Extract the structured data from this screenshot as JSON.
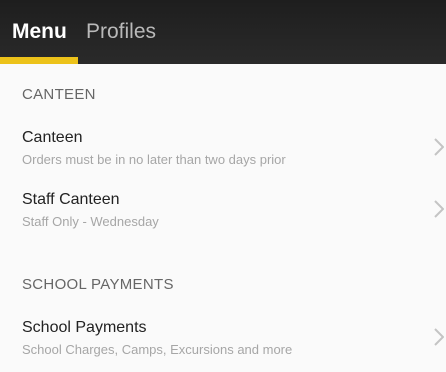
{
  "tabs": {
    "menu_label": "Menu",
    "profiles_label": "Profiles"
  },
  "sections": [
    {
      "header": "CANTEEN",
      "items": [
        {
          "title": "Canteen",
          "subtitle": "Orders must be in no later than two days prior"
        },
        {
          "title": "Staff Canteen",
          "subtitle": "Staff Only - Wednesday"
        }
      ]
    },
    {
      "header": "SCHOOL PAYMENTS",
      "items": [
        {
          "title": "School Payments",
          "subtitle": "School Charges, Camps, Excursions and more"
        }
      ]
    }
  ],
  "icons": {
    "item_chevron": "chevron-right-icon"
  },
  "colors": {
    "accent": "#ecc21a",
    "header_bg": "#222222"
  }
}
